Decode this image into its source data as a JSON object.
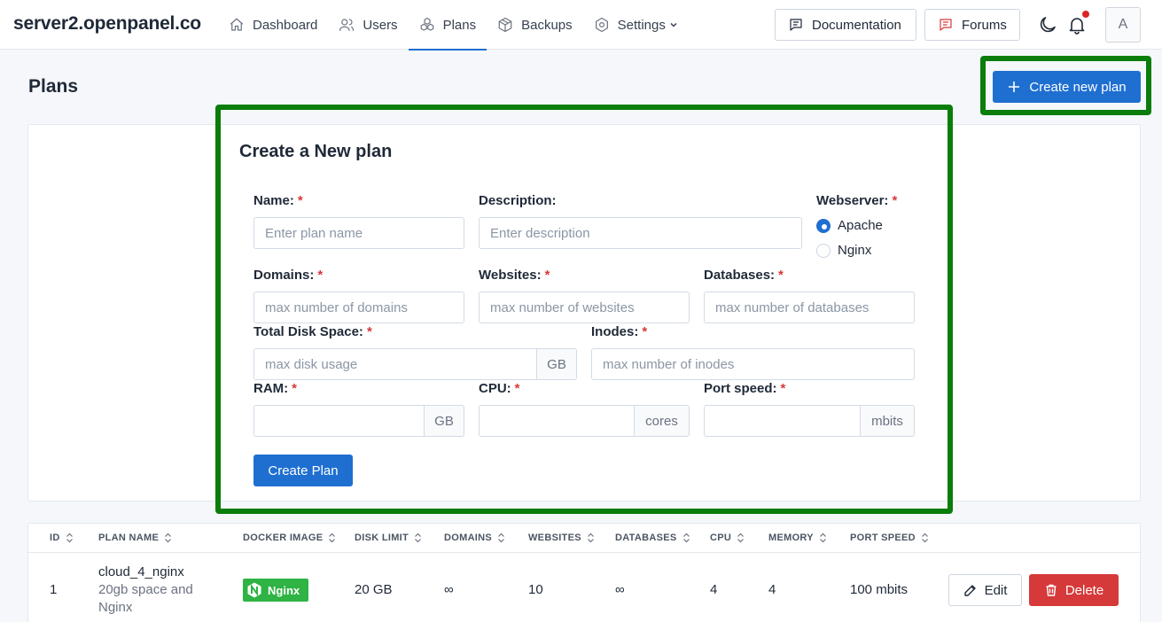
{
  "header": {
    "brand": "server2.openpanel.co",
    "nav": [
      {
        "label": "Dashboard",
        "icon": "home-icon"
      },
      {
        "label": "Users",
        "icon": "users-icon"
      },
      {
        "label": "Plans",
        "icon": "plans-icon",
        "active": true
      },
      {
        "label": "Backups",
        "icon": "box-icon"
      },
      {
        "label": "Settings",
        "icon": "settings-icon"
      }
    ],
    "documentation_label": "Documentation",
    "forums_label": "Forums",
    "avatar_initial": "A",
    "accent_color": "#1f6fd1",
    "notification_dot_color": "#dc2626"
  },
  "page": {
    "title": "Plans",
    "create_button_label": "Create new plan"
  },
  "form": {
    "title": "Create a New plan",
    "required_mark": "*",
    "name": {
      "label": "Name:",
      "placeholder": "Enter plan name"
    },
    "description": {
      "label": "Description:",
      "placeholder": "Enter description"
    },
    "webserver": {
      "label": "Webserver:",
      "options": [
        "Apache",
        "Nginx"
      ],
      "selected": "Apache"
    },
    "domains": {
      "label": "Domains:",
      "placeholder": "max number of domains"
    },
    "websites": {
      "label": "Websites:",
      "placeholder": "max number of websites"
    },
    "databases": {
      "label": "Databases:",
      "placeholder": "max number of databases"
    },
    "disk": {
      "label": "Total Disk Space:",
      "placeholder": "max disk usage",
      "unit": "GB"
    },
    "inodes": {
      "label": "Inodes:",
      "placeholder": "max number of inodes"
    },
    "ram": {
      "label": "RAM:",
      "unit": "GB"
    },
    "cpu": {
      "label": "CPU:",
      "unit": "cores"
    },
    "port_speed": {
      "label": "Port speed:",
      "unit": "mbits"
    },
    "submit_label": "Create Plan"
  },
  "table": {
    "columns": [
      "ID",
      "PLAN NAME",
      "DOCKER IMAGE",
      "DISK LIMIT",
      "DOMAINS",
      "WEBSITES",
      "DATABASES",
      "CPU",
      "MEMORY",
      "PORT SPEED"
    ],
    "rows": [
      {
        "id": "1",
        "name": "cloud_4_nginx",
        "description_line1": "20gb space and",
        "description_line2": "Nginx",
        "docker_image": "Nginx",
        "docker_image_color": "#2fb344",
        "disk_limit": "20 GB",
        "domains": "∞",
        "websites": "10",
        "databases": "∞",
        "cpu": "4",
        "memory": "4",
        "port_speed": "100 mbits",
        "edit_label": "Edit",
        "delete_label": "Delete"
      }
    ]
  },
  "annotation_color": "#0a7d0a"
}
